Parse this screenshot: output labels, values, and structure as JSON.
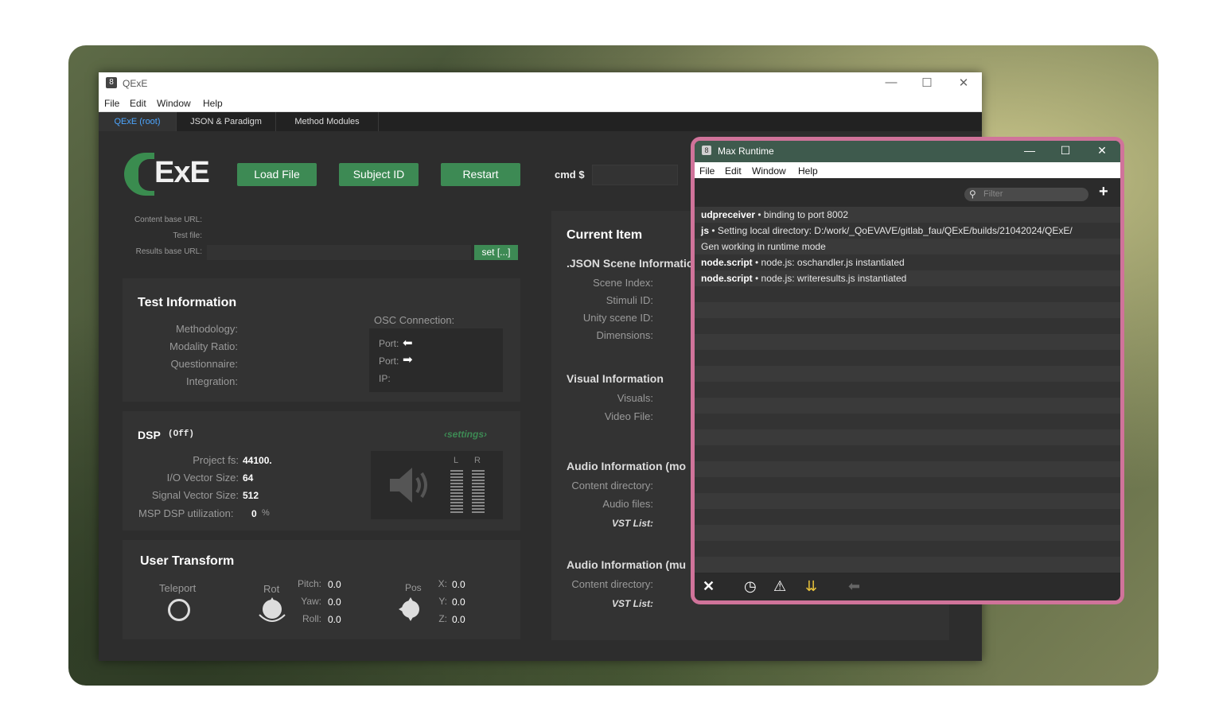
{
  "main_window": {
    "title": "QExE",
    "menu": [
      "File",
      "Edit",
      "Window",
      "Help"
    ],
    "tabs": [
      "QExE (root)",
      "JSON & Paradigm",
      "Method Modules"
    ],
    "logo_text": "ExE",
    "buttons": {
      "load": "Load File",
      "subject": "Subject ID",
      "restart": "Restart"
    },
    "cmd_label": "cmd $",
    "urls": {
      "content": "Content base URL:",
      "test": "Test file:",
      "results": "Results base URL:",
      "set": "set [...]"
    },
    "test_info": {
      "title": "Test Information",
      "labels": [
        "Methodology:",
        "Modality Ratio:",
        "Questionnaire:",
        "Integration:"
      ],
      "osc_title": "OSC Connection:",
      "port_in": "Port:",
      "port_out": "Port:",
      "ip": "IP:"
    },
    "dsp": {
      "title": "DSP",
      "state": "(Off)",
      "settings": "‹settings›",
      "labels": [
        "Project fs:",
        "I/O Vector Size:",
        "Signal Vector Size:",
        "MSP DSP utilization:"
      ],
      "values": [
        "44100.",
        "64",
        "512",
        "0"
      ],
      "pct": "%",
      "L": "L",
      "R": "R"
    },
    "user_transform": {
      "title": "User Transform",
      "teleport": "Teleport",
      "rot": "Rot",
      "pos": "Pos",
      "rot_labels": [
        "Pitch:",
        "Yaw:",
        "Roll:"
      ],
      "rot_values": [
        "0.0",
        "0.0",
        "0.0"
      ],
      "pos_labels": [
        "X:",
        "Y:",
        "Z:"
      ],
      "pos_values": [
        "0.0",
        "0.0",
        "0.0"
      ]
    },
    "current_item": {
      "title": "Current Item",
      "json_hdr": ".JSON Scene Informatio",
      "json_labels": [
        "Scene Index:",
        "Stimuli ID:",
        "Unity scene ID:",
        "Dimensions:"
      ],
      "visual_hdr": "Visual Information",
      "visual_labels": [
        "Visuals:",
        "Video File:"
      ],
      "audio_mono_hdr": "Audio Information (mo",
      "audio_mono_labels": [
        "Content directory:",
        "Audio files:",
        "VST List:"
      ],
      "audio_multi_hdr": "Audio Information (mu",
      "audio_multi_labels": [
        "Content directory:",
        "VST List:"
      ]
    }
  },
  "max_runtime": {
    "title": "Max Runtime",
    "menu": [
      "File",
      "Edit",
      "Window",
      "Help"
    ],
    "filter_placeholder": "Filter",
    "log": [
      {
        "src": "udpreceiver",
        "msg": " • binding to port 8002"
      },
      {
        "src": "js",
        "msg": " • Setting local directory:   D:/work/_QoEVAVE/gitlab_fau/QExE/builds/21042024/QExE/"
      },
      {
        "src": "",
        "msg": "Gen working in runtime mode"
      },
      {
        "src": "node.script",
        "msg": " • node.js: oschandler.js instantiated"
      },
      {
        "src": "node.script",
        "msg": " • node.js: writeresults.js instantiated"
      }
    ]
  }
}
